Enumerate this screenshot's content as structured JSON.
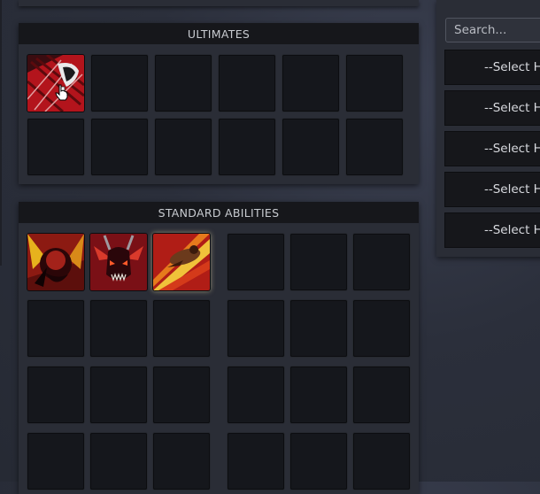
{
  "ultimates": {
    "title": "ULTIMATES"
  },
  "standard": {
    "title": "STANDARD ABILITIES"
  },
  "hero_picker": {
    "search_placeholder": "Search...",
    "select_labels": [
      "--Select He",
      "--Select He",
      "--Select He",
      "--Select He",
      "--Select He"
    ]
  }
}
